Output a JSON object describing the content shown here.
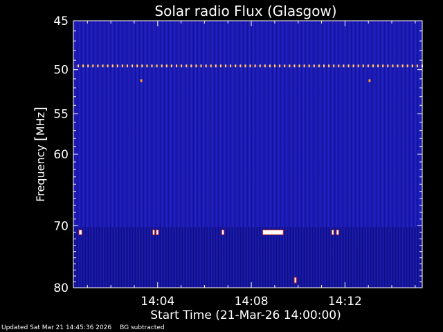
{
  "chart_data": {
    "type": "heatmap",
    "title": "Solar radio Flux (Glasgow)",
    "xlabel": "Start Time (21-Mar-26 14:00:00)",
    "ylabel_text": "Frequency ",
    "ylabel_unit": "MHz",
    "x_tick_labels": [
      "14:04",
      "14:08",
      "14:12"
    ],
    "x_tick_minutes": [
      4,
      8,
      12
    ],
    "xlim_minutes": [
      0.4,
      15.3
    ],
    "y_tick_labels": [
      "45",
      "50",
      "55",
      "60",
      "70",
      "80"
    ],
    "y_tick_values": [
      45,
      50,
      55,
      60,
      70,
      80
    ],
    "ylim": [
      45,
      80
    ],
    "y_scale": "log",
    "y_inverted": true,
    "background_color": "#1a1ab4",
    "features": [
      {
        "kind": "interference-band",
        "freq_mhz": 49.6
      },
      {
        "kind": "spot",
        "t_min": 3.3,
        "freq_mhz": 51.2
      },
      {
        "kind": "spot",
        "t_min": 13.05,
        "freq_mhz": 51.2
      },
      {
        "kind": "burst",
        "t_start_min": 0.65,
        "t_end_min": 0.75,
        "freq_mhz": 71.0
      },
      {
        "kind": "burst",
        "t_start_min": 3.8,
        "t_end_min": 3.85,
        "freq_mhz": 71.0
      },
      {
        "kind": "burst",
        "t_start_min": 3.95,
        "t_end_min": 4.02,
        "freq_mhz": 71.0
      },
      {
        "kind": "burst",
        "t_start_min": 6.75,
        "t_end_min": 6.82,
        "freq_mhz": 71.0
      },
      {
        "kind": "burst",
        "t_start_min": 8.5,
        "t_end_min": 9.35,
        "freq_mhz": 71.0
      },
      {
        "kind": "burst",
        "t_start_min": 11.45,
        "t_end_min": 11.5,
        "freq_mhz": 71.0
      },
      {
        "kind": "burst",
        "t_start_min": 11.65,
        "t_end_min": 11.72,
        "freq_mhz": 71.0
      },
      {
        "kind": "burst",
        "t_start_min": 9.85,
        "t_end_min": 9.88,
        "freq_mhz": 78.7
      }
    ]
  },
  "footer": {
    "updated": "Updated Sat Mar 21 14:45:36 2026",
    "note": "BG subtracted"
  },
  "colors": {
    "axes": "#ffffff",
    "interference": "#ffd27a",
    "burst": "#ffffff",
    "burst_edge": "#ff3000"
  }
}
